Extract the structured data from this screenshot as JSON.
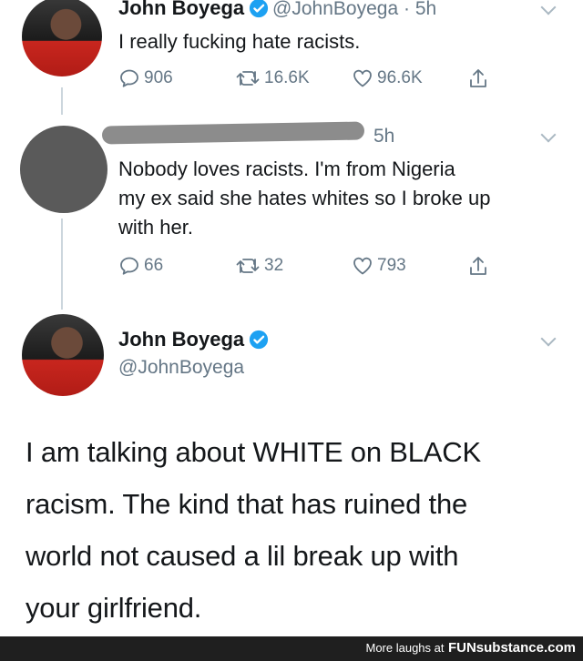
{
  "tweet1": {
    "name": "John Boyega",
    "handle": "@JohnBoyega",
    "time": "5h",
    "text": "I really fucking hate racists.",
    "replies": "906",
    "retweets": "16.6K",
    "likes": "96.6K"
  },
  "tweet2": {
    "time": "5h",
    "lines": [
      "Nobody loves racists. I'm from Nigeria",
      "my ex said she hates whites so I broke up",
      "with her."
    ],
    "replies": "66",
    "retweets": "32",
    "likes": "793"
  },
  "tweet3": {
    "name": "John Boyega",
    "handle": "@JohnBoyega",
    "lines": [
      "I am talking about WHITE on BLACK",
      "racism. The kind that has ruined the",
      "world not caused a lil break up with",
      "your girlfriend."
    ]
  },
  "footer": {
    "text": "More laughs at",
    "brand": "FUNsubstance.com"
  },
  "colors": {
    "verified": "#1da1f2",
    "muted": "#657786",
    "footer_bg": "#1f1f1f"
  }
}
